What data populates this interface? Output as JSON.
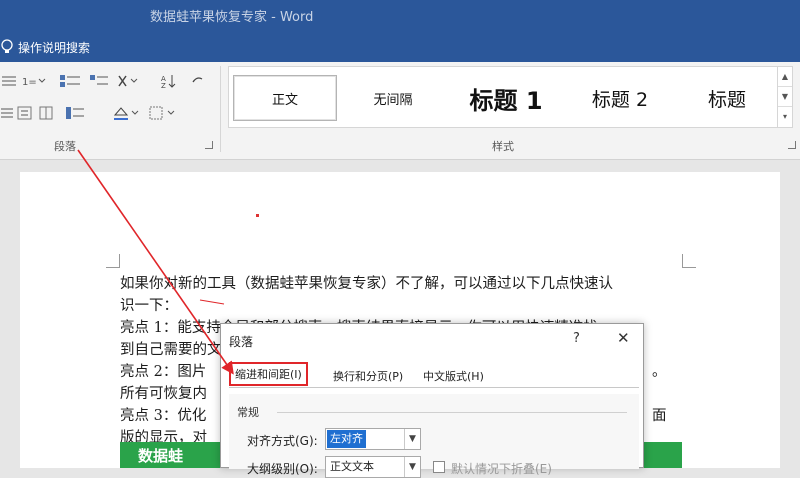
{
  "titlebar": {
    "title": "数据蛙苹果恢复专家 - Word"
  },
  "tellbar": {
    "text": "操作说明搜索"
  },
  "ribbon": {
    "paragraph_group_label": "段落",
    "styles_group_label": "样式",
    "styles": [
      "正文",
      "无间隔",
      "标题 1",
      "标题 2",
      "标题"
    ]
  },
  "document": {
    "lines": [
      "如果你对新的工具（数据蛙苹果恢复专家）不了解，可以通过以下几点快速认",
      "识一下：",
      "亮点 1：能支持全局和部分搜索，搜索结果直接显示，你可以用快速精准找",
      "到自己需要的文件",
      "亮点 2：图片",
      "所有可恢复内",
      "亮点 3：优化",
      "版的显示，对"
    ],
    "right_frags": [
      {
        "text": "。",
        "line": 4
      },
      {
        "text": "面",
        "line": 6
      }
    ],
    "banner_text": "数据蛙"
  },
  "dialog": {
    "title": "段落",
    "help": "?",
    "close": "✕",
    "tabs": [
      "缩进和间距(I)",
      "换行和分页(P)",
      "中文版式(H)"
    ],
    "section": "常规",
    "alignment_label": "对齐方式(G):",
    "alignment_value": "左对齐",
    "outline_label": "大纲级别(O):",
    "outline_value": "正文文本",
    "collapse_label": "默认情况下折叠(E)"
  },
  "colors": {
    "titlebar": "#2b579a",
    "highlight": "#e0262a",
    "select_fill": "#1f6fd1"
  }
}
